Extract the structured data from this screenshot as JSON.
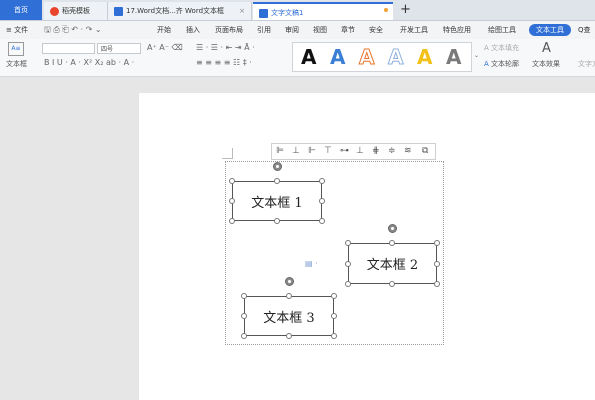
{
  "tabs": {
    "home": "首页",
    "tab1": "稻壳模板",
    "tab2": "17.Word文档...齐 Word文本框",
    "tab3": "文字文稿1",
    "new_tab": "+"
  },
  "menu": {
    "file": "≡ 文件",
    "items": [
      "开始",
      "插入",
      "页面布局",
      "引用",
      "审阅",
      "视图",
      "章节",
      "安全",
      "开发工具",
      "特色应用",
      "绘图工具"
    ],
    "text_tool": "文本工具",
    "search": "Q查"
  },
  "ribbon": {
    "textbox_label": "文本框",
    "font_name": "",
    "font_size": "四号",
    "style_letters": [
      "A",
      "A",
      "A",
      "A",
      "A",
      "A"
    ],
    "style_colors": [
      "#111111",
      "#3a7fd5",
      "#e8752a",
      "#8fb0dd",
      "#f2c21b",
      "#7a7a7a"
    ],
    "text_fill": "文本填充",
    "text_outline": "文本轮廓",
    "text_effect": "文本效果",
    "text_dir": "文字方"
  },
  "document": {
    "textboxes": [
      "文本框 1",
      "文本框 2",
      "文本框 3"
    ]
  }
}
